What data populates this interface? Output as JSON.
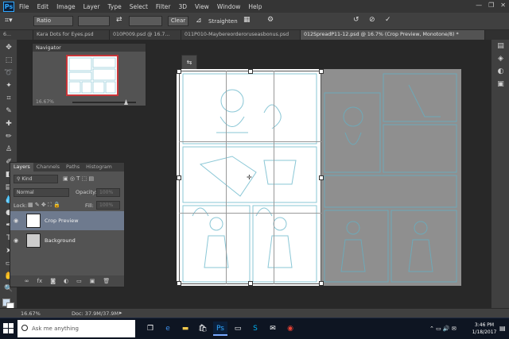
{
  "menu": {
    "logo": "Ps",
    "items": [
      "File",
      "Edit",
      "Image",
      "Layer",
      "Type",
      "Select",
      "Filter",
      "3D",
      "View",
      "Window",
      "Help"
    ]
  },
  "options": {
    "ratio": "Ratio",
    "clear": "Clear",
    "straighten": "Straighten"
  },
  "tabs": [
    {
      "label": "6...",
      "active": false
    },
    {
      "label": "Kara Dots for Eyes.psd",
      "active": false
    },
    {
      "label": "010P009.psd @ 16.7...",
      "active": false
    },
    {
      "label": "011P010-Maybereorderoruseasbonus.psd",
      "active": false
    },
    {
      "label": "012SpreadP11-12.psd @ 16.7% (Crop Preview, Monotone/8) *",
      "active": true
    }
  ],
  "navigator": {
    "title": "Navigator",
    "zoom": "16.67%"
  },
  "layers": {
    "tabs": [
      "Layers",
      "Channels",
      "Paths",
      "Histogram"
    ],
    "kind": "Kind",
    "blend_mode": "Normal",
    "opacity_label": "Opacity:",
    "opacity_value": "100%",
    "lock_label": "Lock:",
    "fill_label": "Fill:",
    "fill_value": "100%",
    "items": [
      {
        "name": "Crop Preview",
        "selected": true
      },
      {
        "name": "Background",
        "selected": false
      }
    ]
  },
  "status": {
    "zoom": "16.67%",
    "doc": "Doc: 37.9M/37.9M"
  },
  "taskbar": {
    "search_placeholder": "Ask me anything",
    "time": "3:46 PM",
    "date": "1/18/2017"
  }
}
